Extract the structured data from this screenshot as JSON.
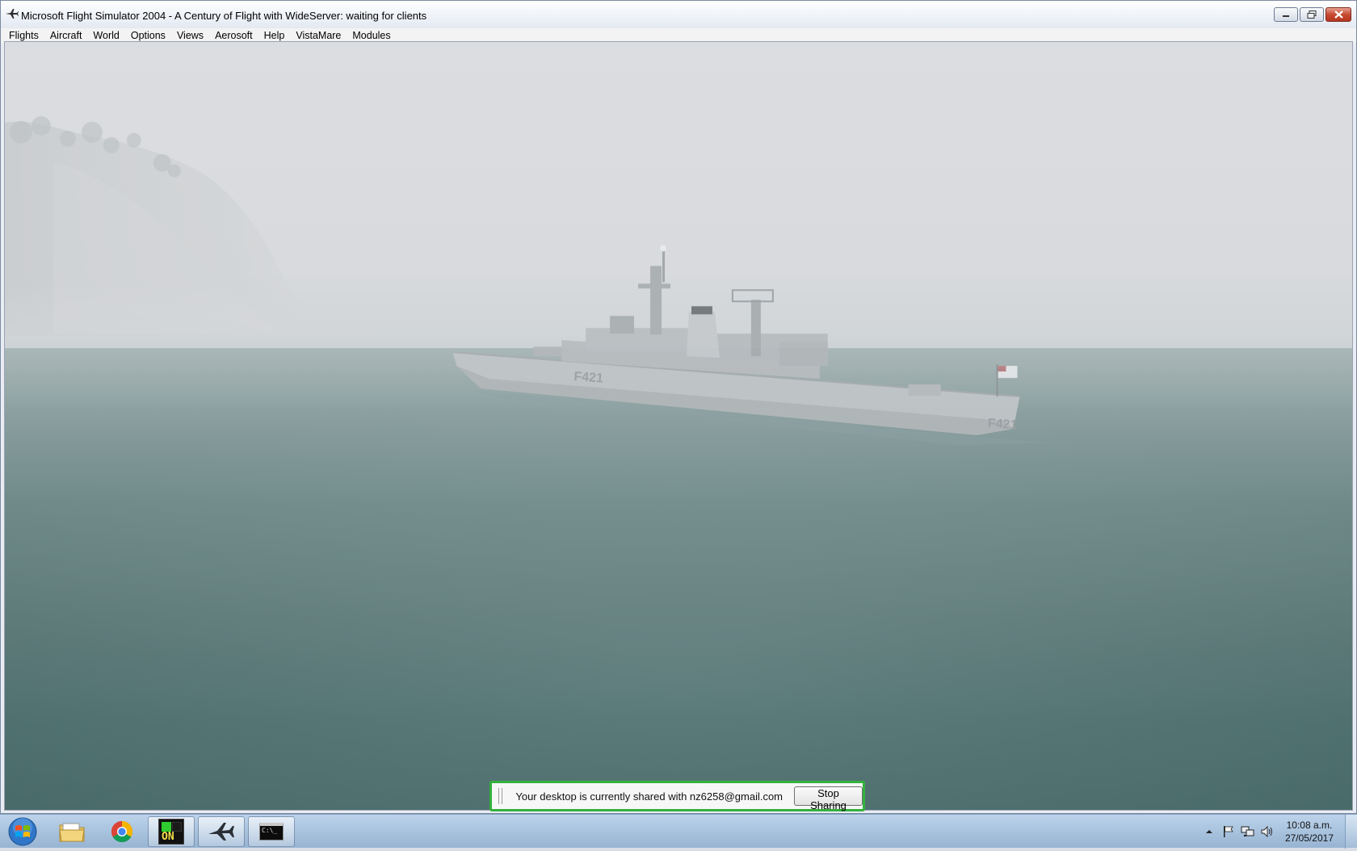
{
  "window": {
    "title": "Microsoft Flight Simulator 2004 - A Century of Flight with WideServer: waiting for clients",
    "icon": "airplane-icon",
    "controls": [
      "minimize-icon",
      "maximize-icon",
      "close-icon"
    ]
  },
  "menu": {
    "items": [
      "Flights",
      "Aircraft",
      "World",
      "Options",
      "Views",
      "Aerosoft",
      "Help",
      "VistaMare",
      "Modules"
    ]
  },
  "scene": {
    "hull_marking": "F421",
    "stern_marking": "F421"
  },
  "share_bar": {
    "message": "Your desktop is currently shared with nz6258@gmail.com",
    "button_label": "Stop Sharing",
    "accent": "#34b13c"
  },
  "taskbar": {
    "items": [
      {
        "name": "start-orb",
        "icon": "windows-logo-icon"
      },
      {
        "name": "file-explorer",
        "icon": "folder-icon"
      },
      {
        "name": "chrome",
        "icon": "chrome-icon"
      },
      {
        "name": "on-app",
        "icon": "on-indicator-icon",
        "label": "ON"
      },
      {
        "name": "flight-simulator",
        "icon": "airplane-icon"
      },
      {
        "name": "command-prompt",
        "icon": "cmd-icon",
        "label": "C:\\_"
      }
    ],
    "tray_icons": [
      "show-hidden-icon",
      "action-center-flag-icon",
      "network-icon",
      "volume-icon"
    ],
    "clock_time": "10:08 a.m.",
    "clock_date": "27/05/2017"
  }
}
